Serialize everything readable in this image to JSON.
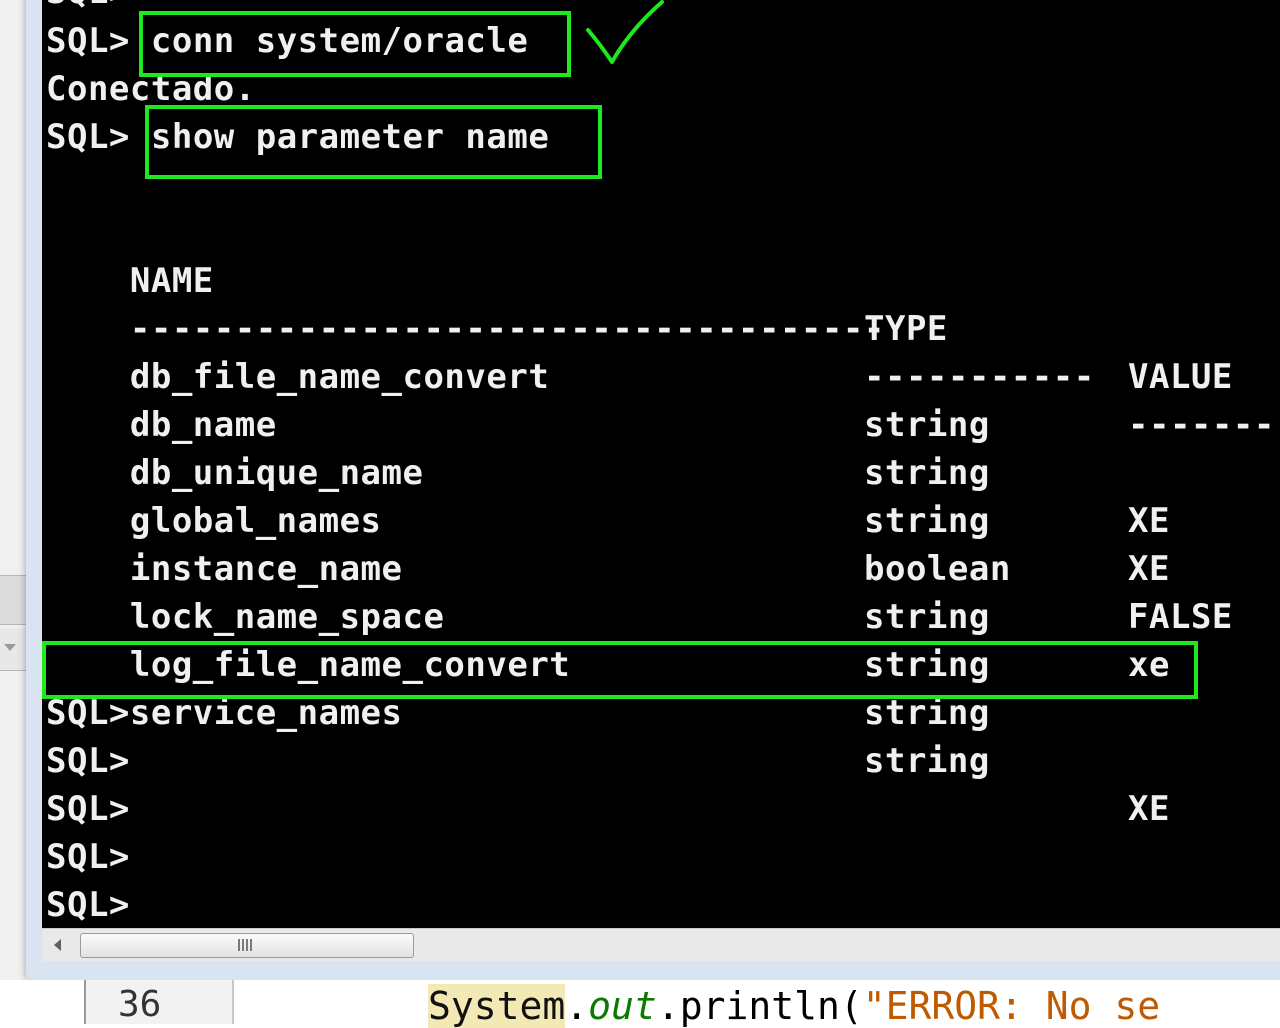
{
  "console": {
    "lines": [
      {
        "prompt": "SQL>",
        "command": "conn system/oracle"
      },
      {
        "text": "Conectado."
      },
      {
        "prompt": "SQL>",
        "command": "show parameter name"
      }
    ],
    "table": {
      "headers": {
        "name": "NAME",
        "type": "TYPE",
        "value": "VALUE"
      },
      "separator": {
        "name": "------------------------------------",
        "type": "-----------",
        "value": "-------"
      },
      "rows": [
        {
          "name": "db_file_name_convert",
          "type": "string",
          "value": ""
        },
        {
          "name": "db_name",
          "type": "string",
          "value": "XE"
        },
        {
          "name": "db_unique_name",
          "type": "string",
          "value": "XE"
        },
        {
          "name": "global_names",
          "type": "boolean",
          "value": "FALSE"
        },
        {
          "name": "instance_name",
          "type": "string",
          "value": "xe"
        },
        {
          "name": "lock_name_space",
          "type": "string",
          "value": ""
        },
        {
          "name": "log_file_name_convert",
          "type": "string",
          "value": ""
        },
        {
          "name": "service_names",
          "type": "string",
          "value": "XE"
        }
      ]
    },
    "trailing_prompts": [
      "SQL>",
      "SQL>",
      "SQL>",
      "SQL>",
      "SQL>"
    ],
    "top_cut_text": "SQL>"
  },
  "annotations": {
    "color": "#1ee81e"
  },
  "editor": {
    "line_number": "36",
    "code": {
      "class_name": "System",
      "dot1": ".",
      "field": "out",
      "method": ".println(",
      "string": "\"ERROR: No se"
    }
  }
}
